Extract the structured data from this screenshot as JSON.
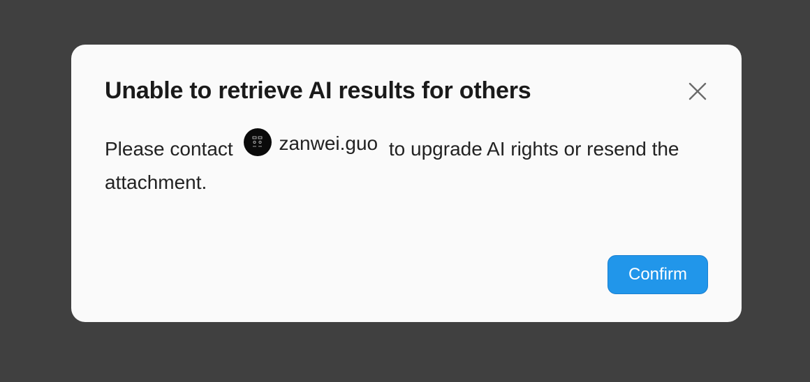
{
  "dialog": {
    "title": "Unable to retrieve AI results for others",
    "close_icon": "close-icon",
    "message_before": "Please contact",
    "mention": {
      "name": "zanwei.guo",
      "avatar_icon": "user-avatar-icon"
    },
    "message_after": "to upgrade AI rights or resend the attachment.",
    "confirm_label": "Confirm"
  },
  "colors": {
    "backdrop": "#404040",
    "dialog_background": "#fafafa",
    "primary_button": "#2196ea",
    "text": "#222222"
  }
}
